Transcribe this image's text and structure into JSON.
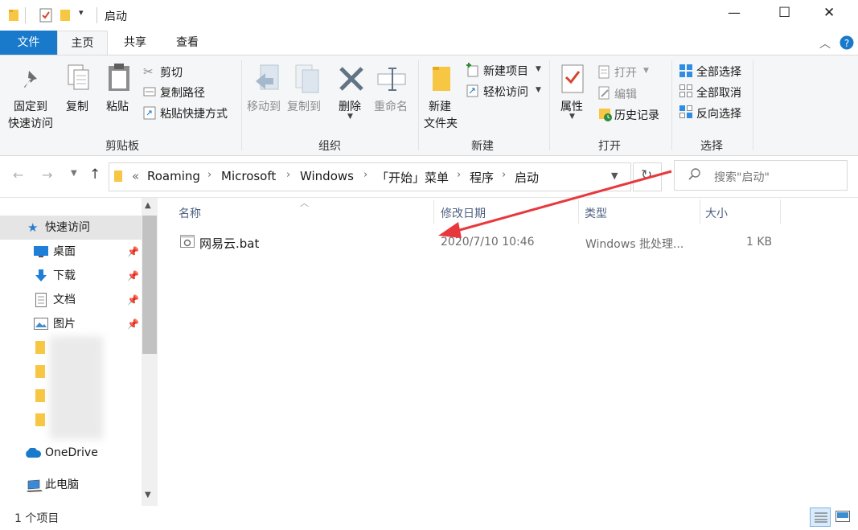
{
  "window": {
    "title": "启动",
    "controls": {
      "minimize": "—",
      "maximize": "☐",
      "close": "✕"
    }
  },
  "tabs": [
    {
      "label": "文件",
      "active": true
    },
    {
      "label": "主页"
    },
    {
      "label": "共享"
    },
    {
      "label": "查看"
    }
  ],
  "ribbon": {
    "clipboard": {
      "label": "剪贴板",
      "pin_line1": "固定到",
      "pin_line2": "快速访问",
      "copy": "复制",
      "paste": "粘贴",
      "cut": "剪切",
      "copy_path": "复制路径",
      "paste_shortcut": "粘贴快捷方式"
    },
    "organize": {
      "label": "组织",
      "move_to": "移动到",
      "copy_to": "复制到",
      "delete": "删除",
      "rename": "重命名"
    },
    "new": {
      "label": "新建",
      "new_item": "新建项目",
      "easy_access": "轻松访问",
      "new_folder_line1": "新建",
      "new_folder_line2": "文件夹"
    },
    "open": {
      "label": "打开",
      "properties": "属性",
      "open": "打开",
      "edit": "编辑",
      "history": "历史记录"
    },
    "select": {
      "label": "选择",
      "select_all": "全部选择",
      "select_none": "全部取消",
      "invert": "反向选择"
    }
  },
  "address": {
    "prefix": "«",
    "crumbs": [
      "Roaming",
      "Microsoft",
      "Windows",
      "「开始」菜单",
      "程序",
      "启动"
    ],
    "search_placeholder": "搜索\"启动\""
  },
  "nav": {
    "quick_access": "快速访问",
    "items": [
      {
        "label": "桌面",
        "pinned": true
      },
      {
        "label": "下载",
        "pinned": true
      },
      {
        "label": "文档",
        "pinned": true
      },
      {
        "label": "图片",
        "pinned": true
      }
    ],
    "onedrive": "OneDrive",
    "this_pc": "此电脑"
  },
  "columns": {
    "name": "名称",
    "modified": "修改日期",
    "type": "类型",
    "size": "大小"
  },
  "files": [
    {
      "name": "网易云.bat",
      "modified": "2020/7/10 10:46",
      "type": "Windows 批处理...",
      "size": "1 KB"
    }
  ],
  "status": {
    "count": "1 个项目"
  },
  "colors": {
    "accent": "#1979ca",
    "nav_selected": "#e5e5e5",
    "annotation_arrow": "#e8383d"
  }
}
